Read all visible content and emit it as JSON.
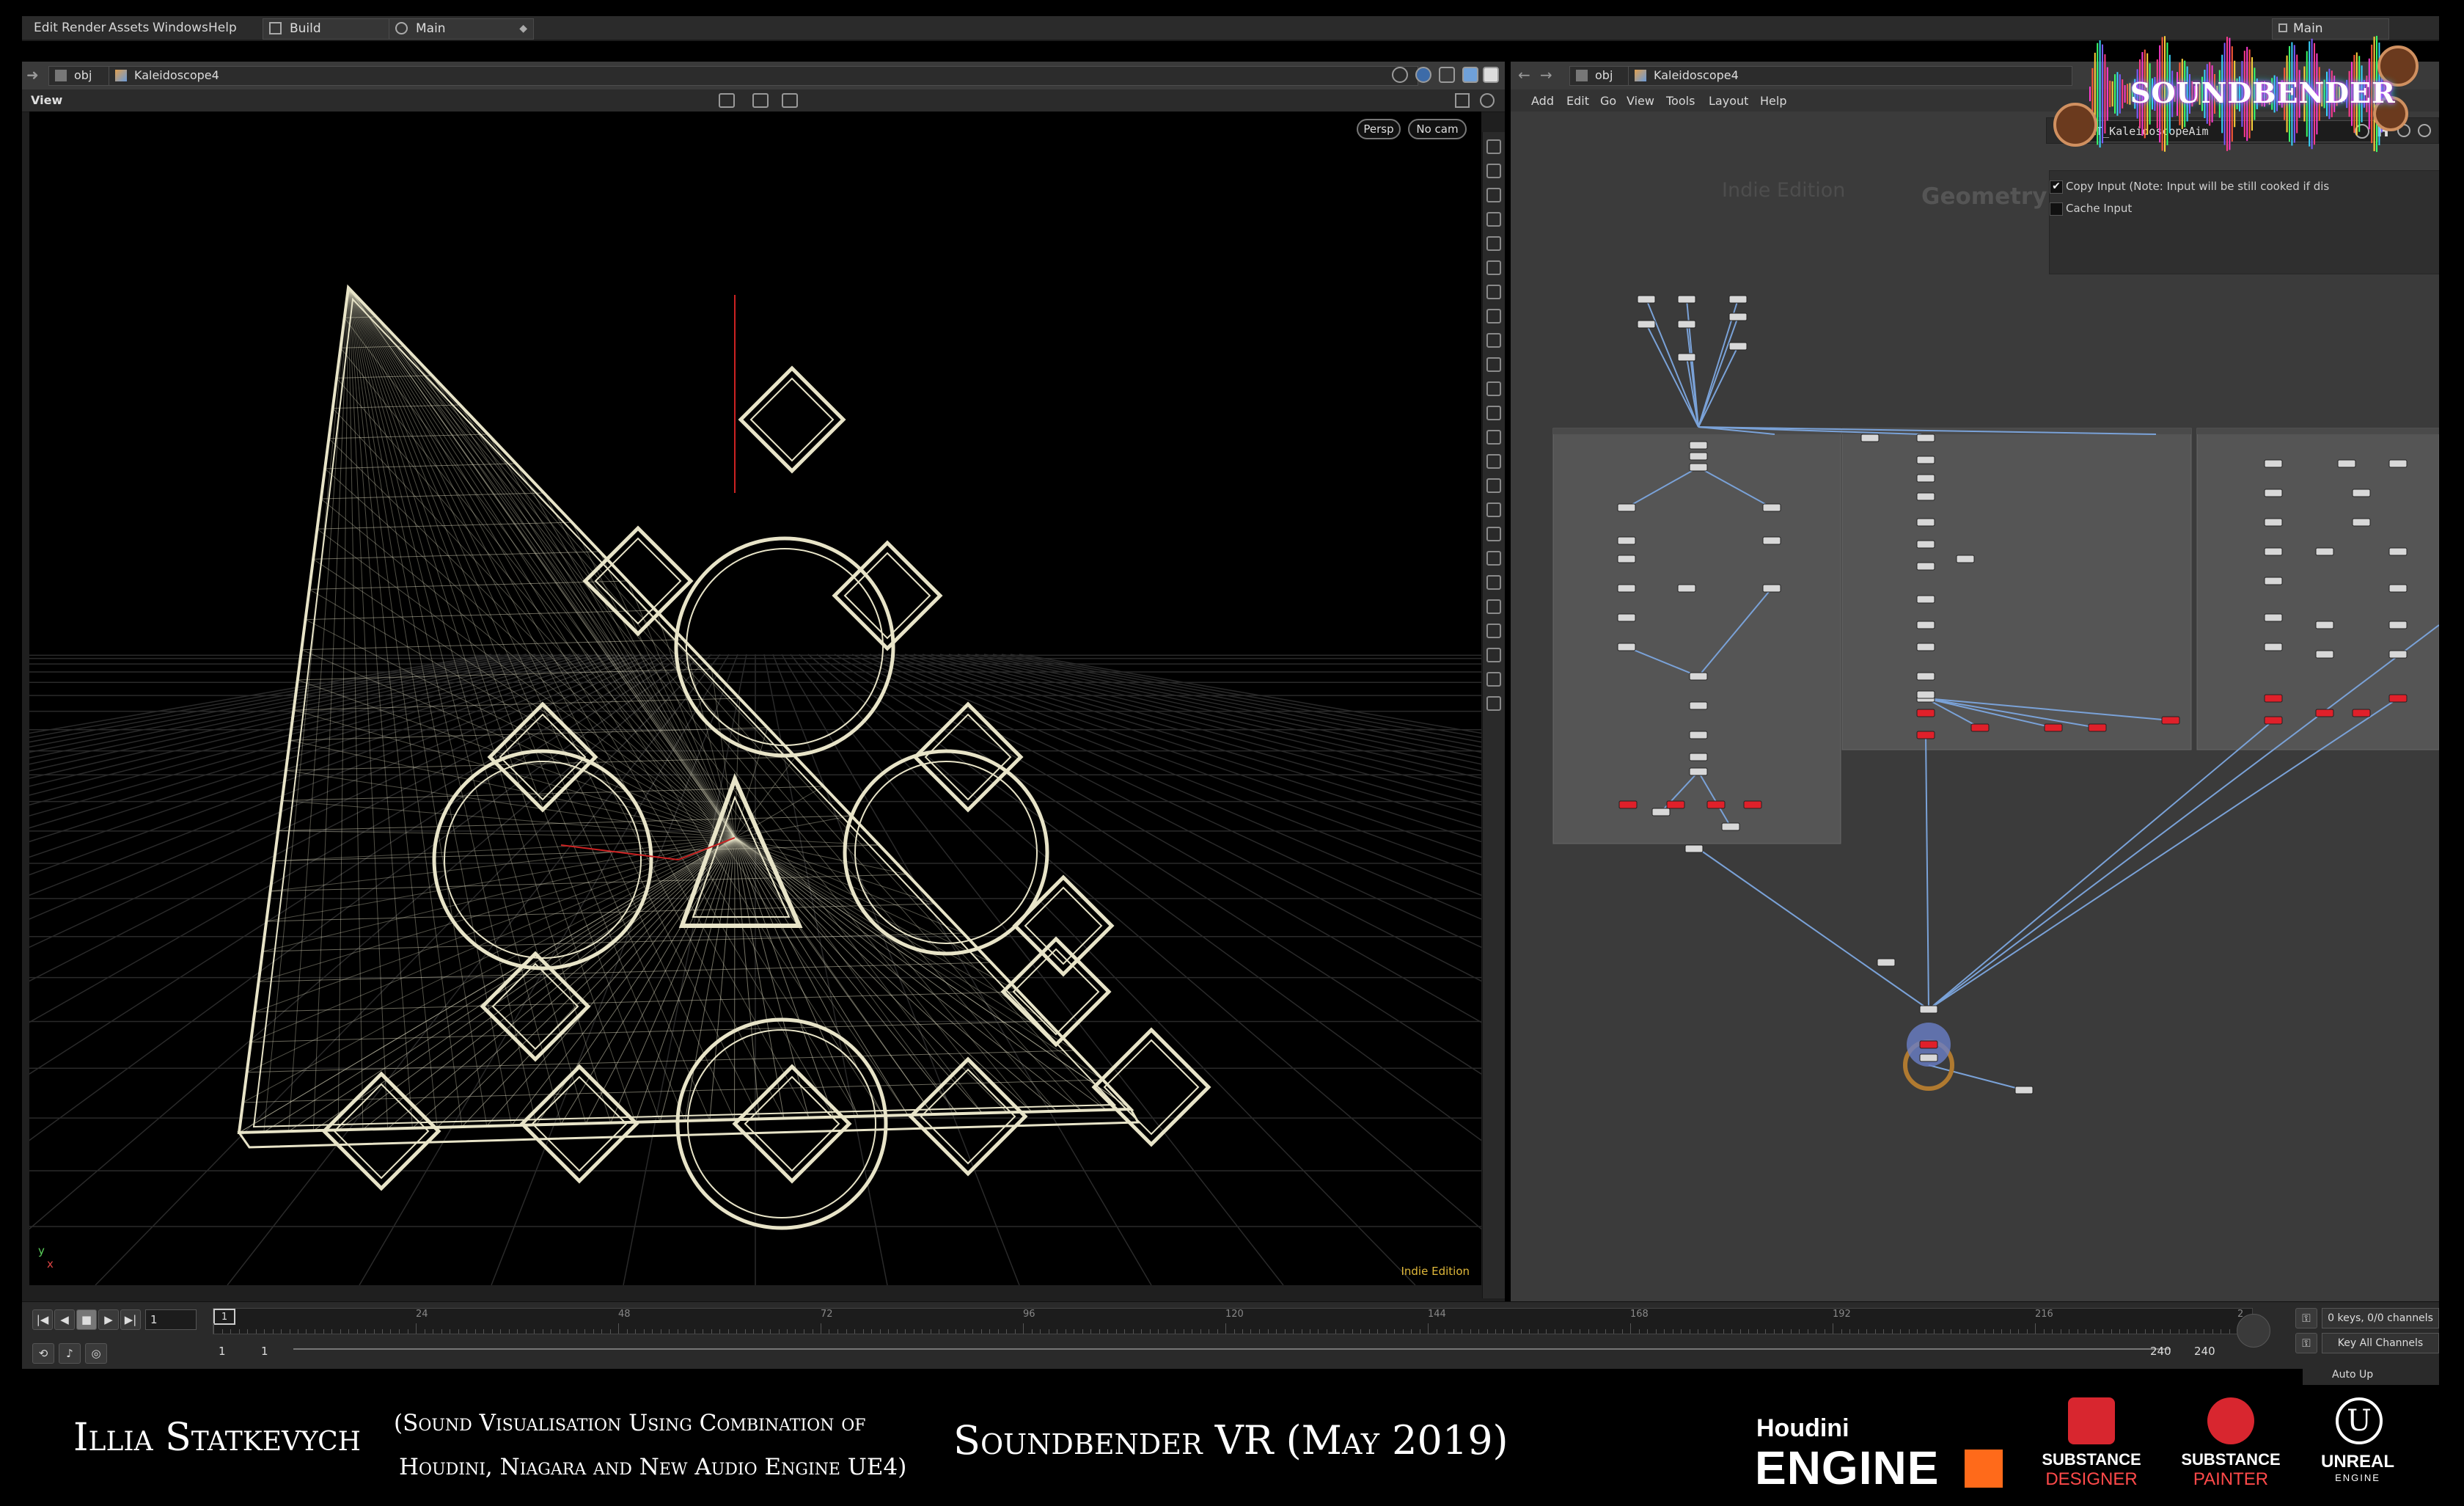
{
  "menubar": {
    "items": [
      "Edit",
      "Render",
      "Assets",
      "Windows",
      "Help"
    ],
    "desktop_label": "Build",
    "main_label": "Main",
    "right_label": "Main"
  },
  "left_pane": {
    "path_root": "obj",
    "path_node": "Kaleidoscope4",
    "header": "View",
    "persp_button": "Persp",
    "cam_button": "No cam",
    "watermark": "Indie Edition",
    "axis_y": "y",
    "axis_x": "x"
  },
  "right_pane": {
    "path_root": "obj",
    "path_node": "Kaleidoscope4",
    "menu": [
      "Add",
      "Edit",
      "Go",
      "View",
      "Tools",
      "Layout",
      "Help"
    ],
    "watermark_edition": "Indie Edition",
    "watermark_context": "Geometry",
    "param_field": "OUT_KaleidoscopeAim",
    "param_checkbox_1": "Copy Input (Note: Input will be still cooked if dis",
    "param_checkbox_2": "Cache Input"
  },
  "logo": {
    "text": "SOUNDBENDER"
  },
  "timeline": {
    "frame": "1",
    "ticks": [
      "1",
      "24",
      "48",
      "72",
      "96",
      "120",
      "144",
      "168",
      "192",
      "216",
      "2"
    ],
    "range_start": "1",
    "range_start2": "1",
    "range_end": "240",
    "range_end2": "240",
    "keys_label": "0 keys, 0/0 channels",
    "key_all_label": "Key All Channels",
    "auto_update": "Auto Up"
  },
  "caption": {
    "author": "Illia Statkevych",
    "subtitle_line1": "(Sound Visualisation Using Combination of",
    "subtitle_line2": "Houdini, Niagara and New Audio Engine UE4)",
    "title": "Soundbender  VR (May 2019)"
  },
  "brand_logos": {
    "houdini_top": "Houdini",
    "houdini_bottom": "ENGINE",
    "substance_designer_1": "SUBSTANCE",
    "substance_designer_2": "DESIGNER",
    "substance_painter_1": "SUBSTANCE",
    "substance_painter_2": "PAINTER",
    "unreal_1": "UNREAL",
    "unreal_2": "ENGINE"
  },
  "colors": {
    "node_red": "#e0202a",
    "node_white": "#d8d8d8",
    "wire_blue": "#7aa2d8",
    "wireframe": "#e8e4c8",
    "accent_orange": "#ff6a1a"
  }
}
